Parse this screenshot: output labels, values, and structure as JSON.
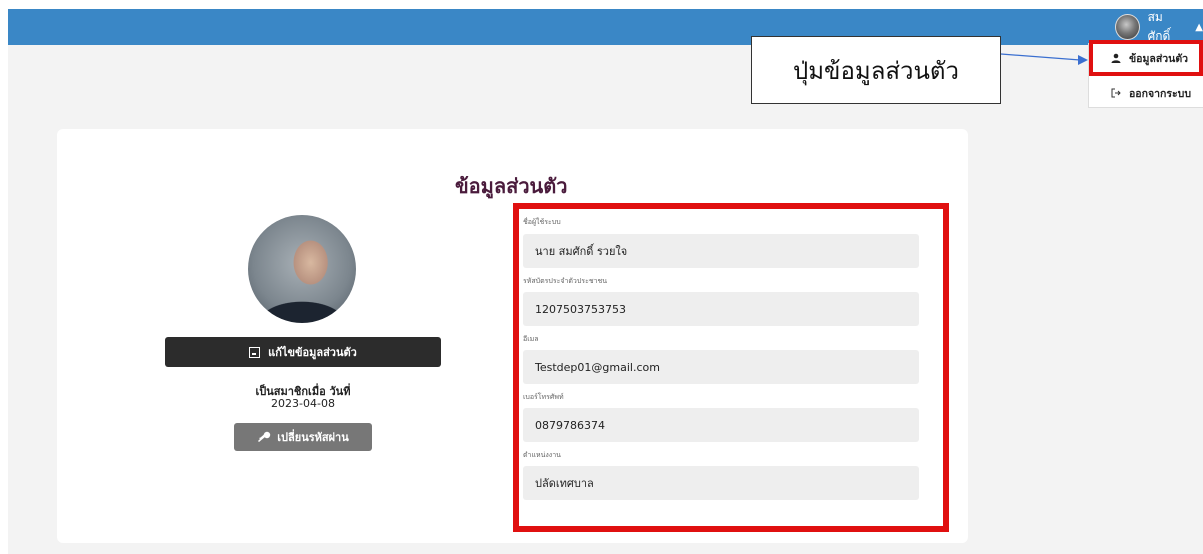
{
  "header": {
    "user_name": "สมศักดิ์",
    "caret": "▲"
  },
  "dropdown": {
    "profile_label": "ข้อมูลส่วนตัว",
    "logout_label": "ออกจากระบบ",
    "profile_icon": "user-icon",
    "logout_icon": "logout-icon"
  },
  "callout": {
    "text": "ปุ่มข้อมูลส่วนตัว"
  },
  "profile": {
    "title": "ข้อมูลส่วนตัว",
    "edit_button": "แก้ไขข้อมูลส่วนตัว",
    "member_since_label": "เป็นสมาชิกเมื่อ วันที่",
    "member_since_date": "2023-04-08",
    "change_password_button": "เปลี่ยนรหัสผ่าน"
  },
  "fields": [
    {
      "label": "ชื่อผู้ใช้ระบบ",
      "value": "นาย สมศักดิ์ รวยใจ"
    },
    {
      "label": "รหัสบัตรประจำตัวประชาชน",
      "value": "1207503753753"
    },
    {
      "label": "อีเมล",
      "value": "Testdep01@gmail.com"
    },
    {
      "label": "เบอร์โทรศัพท์",
      "value": "0879786374"
    },
    {
      "label": "ตำแหน่งงาน",
      "value": "ปลัดเทศบาล"
    }
  ],
  "colors": {
    "topbar": "#3a87c6",
    "highlight": "#e01010",
    "title": "#4a1b3c",
    "button_dark": "#2c2c2c",
    "button_gray": "#777777"
  }
}
